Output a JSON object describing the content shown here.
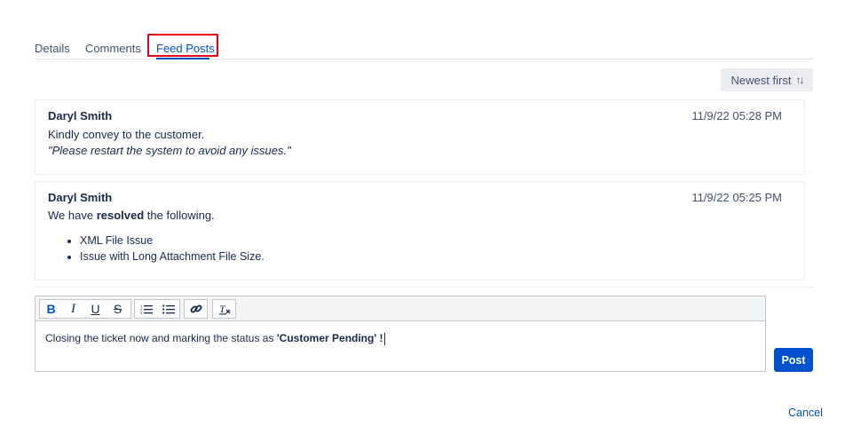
{
  "tabs": [
    {
      "label": "Details"
    },
    {
      "label": "Comments"
    },
    {
      "label": "Feed Posts"
    }
  ],
  "sort": {
    "label": "Newest first",
    "icon": "sort-arrows-icon"
  },
  "posts": [
    {
      "author": "Daryl Smith",
      "timestamp": "11/9/22 05:28 PM",
      "line1": "Kindly convey to the customer.",
      "line2": "\"Please restart the system to avoid any issues.\""
    },
    {
      "author": "Daryl Smith",
      "timestamp": "11/9/22 05:25 PM",
      "text_before": "We have ",
      "text_bold": "resolved",
      "text_after": " the following.",
      "items": [
        "XML File Issue",
        "Issue with Long Attachment File Size."
      ]
    }
  ],
  "toolbar": {
    "bold": "B",
    "italic": "I",
    "underline": "U",
    "strike": "S"
  },
  "editor": {
    "text_before": "Closing the ticket now and marking the status as ",
    "text_bold": "'Customer Pending' !"
  },
  "actions": {
    "post_label": "Post",
    "cancel_label": "Cancel"
  },
  "colors": {
    "accent": "#0052cc",
    "highlight": "#e2001a"
  }
}
